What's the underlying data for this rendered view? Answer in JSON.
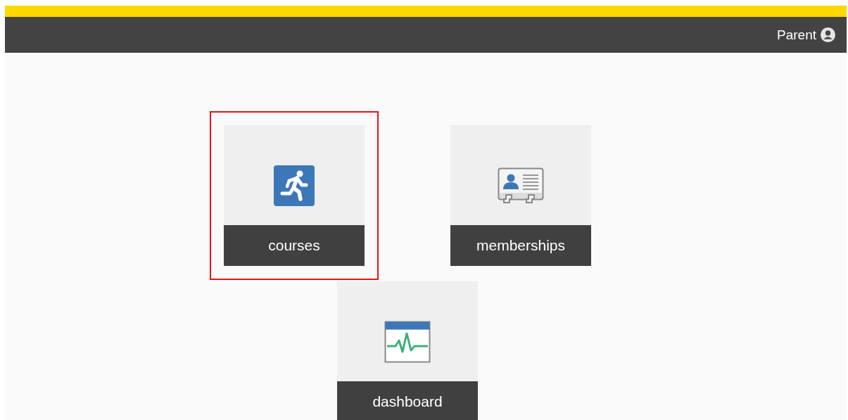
{
  "header": {
    "user_label": "Parent"
  },
  "tiles": [
    {
      "kind": "courses",
      "label": "courses",
      "selected": true
    },
    {
      "kind": "memberships",
      "label": "memberships",
      "selected": false
    },
    {
      "kind": "dashboard",
      "label": "dashboard",
      "selected": false
    }
  ]
}
